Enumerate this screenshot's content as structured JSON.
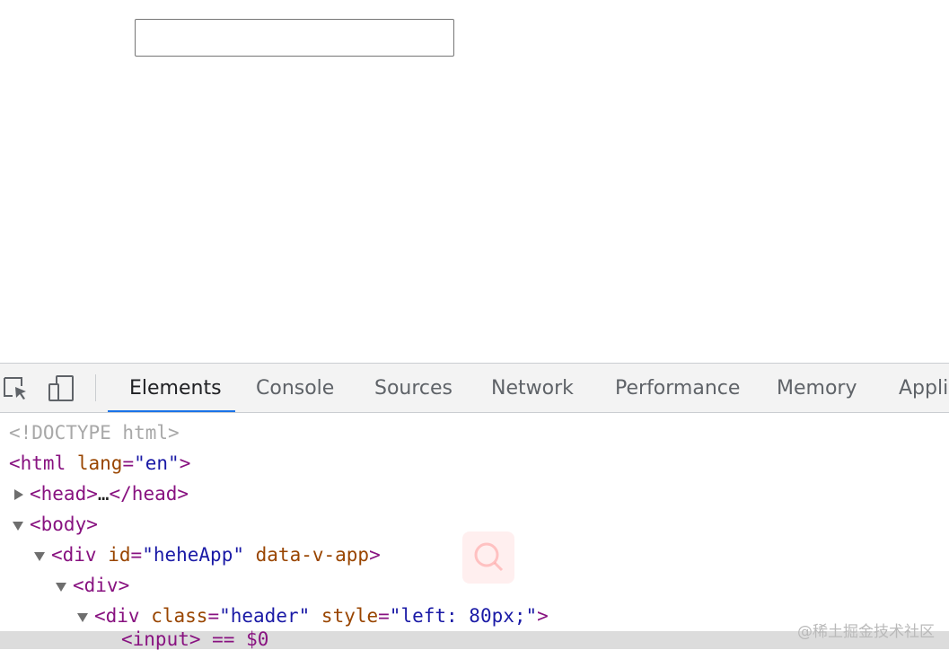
{
  "page": {
    "input_value": ""
  },
  "devtools": {
    "tabs": [
      {
        "label": "Elements"
      },
      {
        "label": "Console"
      },
      {
        "label": "Sources"
      },
      {
        "label": "Network"
      },
      {
        "label": "Performance"
      },
      {
        "label": "Memory"
      },
      {
        "label": "Appli"
      }
    ],
    "active_tab": "Elements",
    "icons": [
      "inspect-element-icon",
      "device-toolbar-icon"
    ],
    "dom": {
      "doctype": "<!DOCTYPE html>",
      "html_open": "<html",
      "html_attr": "lang",
      "html_attr_val": "\"en\"",
      "head_collapsed": "<head>",
      "head_ellipsis": "…",
      "head_close": "</head>",
      "body_open": "<body>",
      "div_app_open": "<div",
      "div_app_attr1": "id",
      "div_app_attr1_val": "\"heheApp\"",
      "div_app_attr2": "data-v-app",
      "div_open": "<div>",
      "div_header_open": "<div",
      "div_header_attr1": "class",
      "div_header_attr1_val": "\"header\"",
      "div_header_attr2": "style",
      "div_header_attr2_val": "\"left: 80px;\"",
      "input_partial": "<input> == $0"
    },
    "colors": {
      "tag": "#881280",
      "attr": "#994500",
      "attr_value": "#1a1aa6",
      "accent": "#1a73e8"
    }
  },
  "watermark": "@稀土掘金技术社区"
}
